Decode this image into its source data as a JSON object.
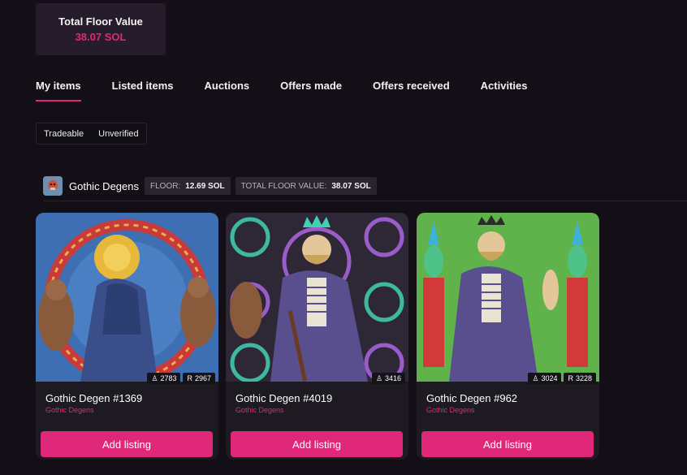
{
  "summary": {
    "label": "Total Floor Value",
    "value": "38.07 SOL"
  },
  "tabs": [
    {
      "label": "My items",
      "active": true
    },
    {
      "label": "Listed items"
    },
    {
      "label": "Auctions"
    },
    {
      "label": "Offers made"
    },
    {
      "label": "Offers received"
    },
    {
      "label": "Activities"
    }
  ],
  "filters": [
    "Tradeable",
    "Unverified"
  ],
  "collection": {
    "name": "Gothic Degens",
    "avatar_icon": "skull-avatar-icon",
    "floor_label": "FLOOR:",
    "floor_value": "12.69 SOL",
    "total_label": "TOTAL FLOOR VALUE:",
    "total_value": "38.07 SOL"
  },
  "cards": [
    {
      "name": "Gothic Degen #1369",
      "collection": "Gothic Degens",
      "holders": "2783",
      "rank": "2967",
      "button": "Add listing",
      "bg": "#3f6fb3"
    },
    {
      "name": "Gothic Degen #4019",
      "collection": "Gothic Degens",
      "holders": "3416",
      "rank": "",
      "button": "Add listing",
      "bg": "#2e2836"
    },
    {
      "name": "Gothic Degen #962",
      "collection": "Gothic Degens",
      "holders": "3024",
      "rank": "3228",
      "button": "Add listing",
      "bg": "#5fb34a"
    }
  ],
  "colors": {
    "accent": "#e0287a",
    "background": "#140f17",
    "card": "#1e1a22"
  }
}
